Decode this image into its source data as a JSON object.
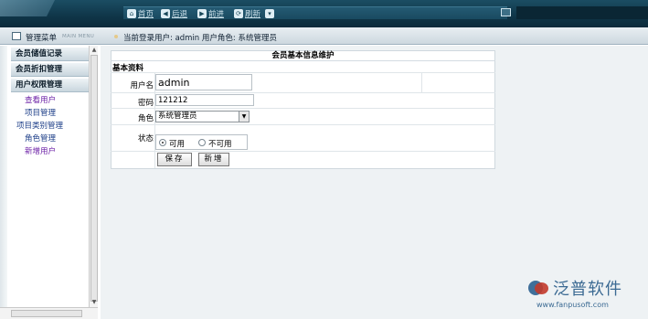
{
  "toolbar": {
    "home": "首页",
    "back": "后退",
    "forward": "前进",
    "refresh": "刷新"
  },
  "menu": {
    "title": "管理菜单",
    "subtitle": "MAIN MENU"
  },
  "user_info": "当前登录用户: admin 用户角色: 系统管理员",
  "sidebar": {
    "sections": [
      {
        "label": "会员储值记录"
      },
      {
        "label": "会员折扣管理"
      },
      {
        "label": "用户权限管理"
      }
    ],
    "links": [
      {
        "label": "查看用户"
      },
      {
        "label": "项目管理"
      },
      {
        "label": "项目类别管理"
      },
      {
        "label": "角色管理"
      },
      {
        "label": "新增用户"
      }
    ]
  },
  "form": {
    "title": "会员基本信息维护",
    "section": "基本资料",
    "username_label": "用户名",
    "username_value": "admin",
    "password_label": "密码",
    "password_value": "121212",
    "role_label": "角色",
    "role_value": "系统管理员",
    "status_label": "状态",
    "status_options": [
      {
        "label": "可用",
        "selected": true
      },
      {
        "label": "不可用",
        "selected": false
      }
    ],
    "save_button": "保存",
    "new_button": "新增"
  },
  "brand": {
    "name": "泛普软件",
    "url": "www.fanpusoft.com",
    "colors": {
      "blue": "#3b6a93",
      "red": "#c23a2b"
    }
  }
}
